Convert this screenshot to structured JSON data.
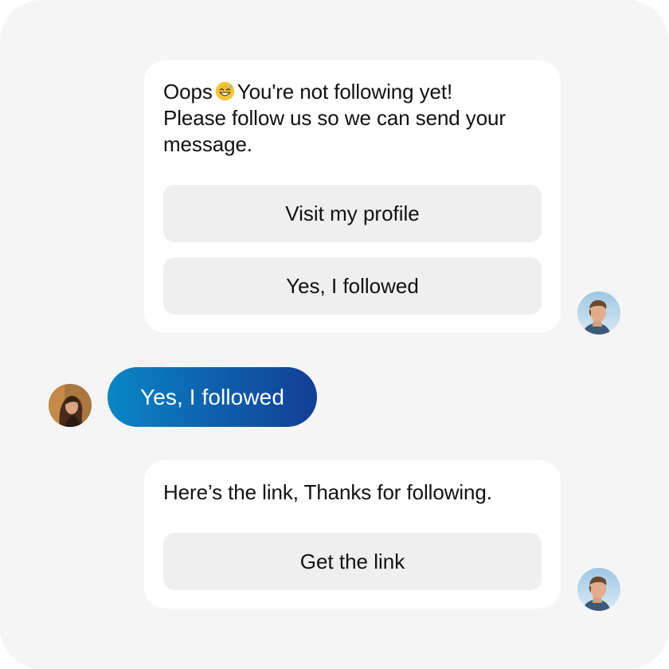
{
  "conversation": {
    "bot_message_1": {
      "text_before_emoji": "Oops",
      "emoji": "grinning-sweat-emoji",
      "text_after_emoji": "You're not following yet!\nPlease follow us so we can send your message.",
      "buttons": [
        {
          "label": "Visit my profile"
        },
        {
          "label": "Yes, I followed"
        }
      ]
    },
    "user_reply": {
      "text": "Yes, I followed"
    },
    "bot_message_2": {
      "text": "Here’s the link, Thanks for following.",
      "buttons": [
        {
          "label": "Get the link"
        }
      ]
    }
  },
  "colors": {
    "canvas_bg": "#f5f5f5",
    "card_bg": "#ffffff",
    "button_bg": "#efefef",
    "user_bubble_gradient_start": "#0a86c4",
    "user_bubble_gradient_end": "#123f95"
  },
  "icons": {
    "bot_avatar": "man-avatar",
    "user_avatar": "woman-avatar"
  }
}
